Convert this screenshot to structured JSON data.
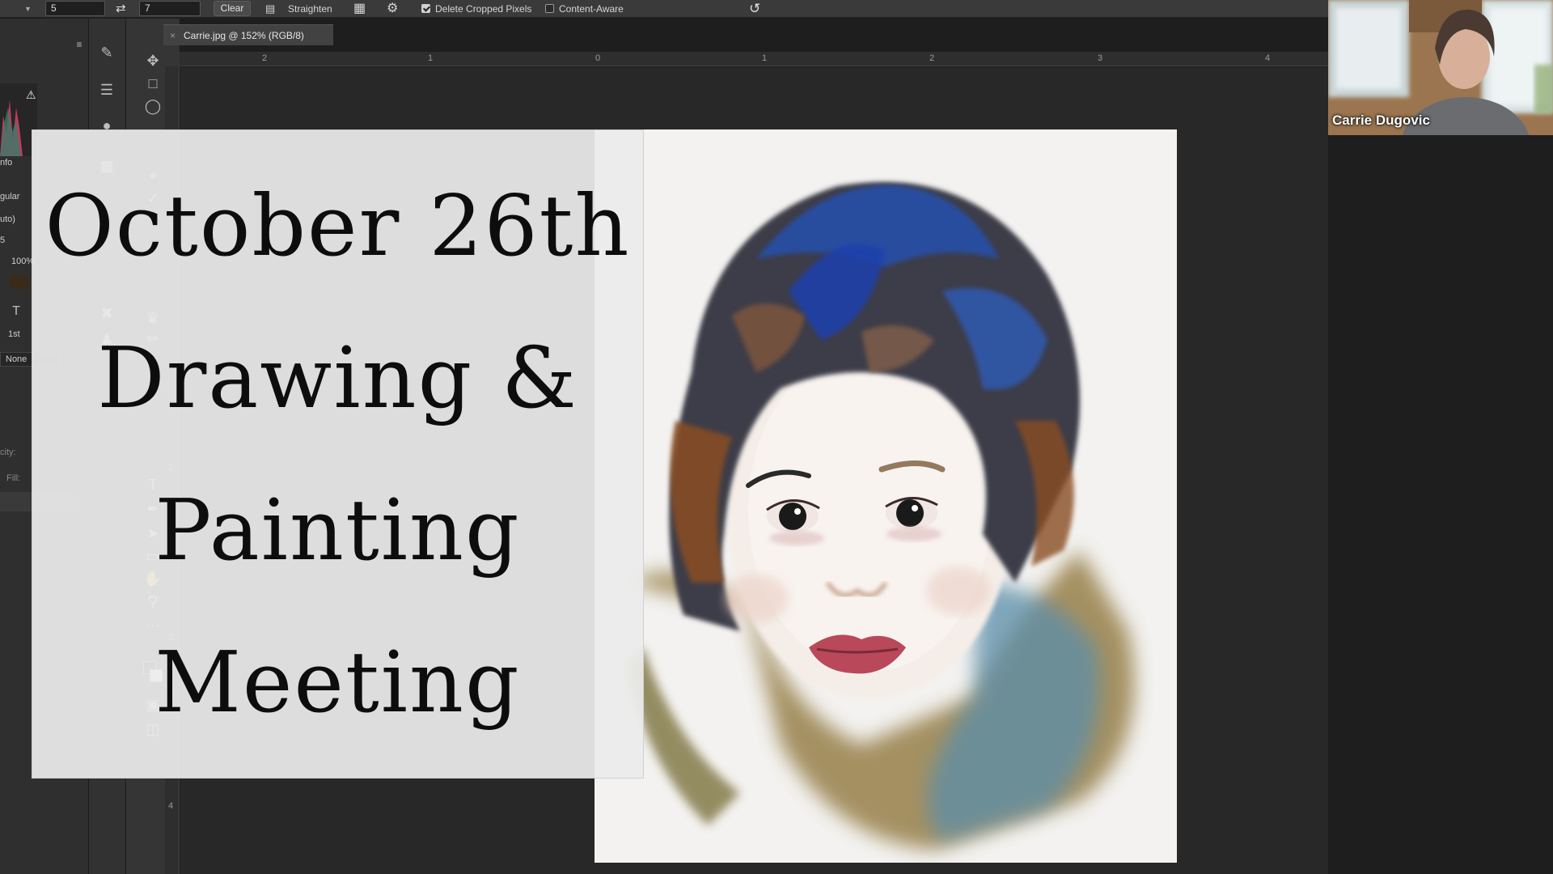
{
  "options_bar": {
    "width_value": "5",
    "height_value": "7",
    "clear_label": "Clear",
    "straighten_label": "Straighten",
    "delete_cropped_label": "Delete Cropped Pixels",
    "delete_cropped_checked": true,
    "content_aware_label": "Content-Aware",
    "content_aware_checked": false
  },
  "left_panel": {
    "info_tab": "nfo",
    "blend_mode": "gular",
    "auto_label": "uto)",
    "value_5": "5",
    "percent": "100%",
    "first_label": "1st",
    "none_label": "None",
    "opacity_label": "city:",
    "fill_label": "Fill:"
  },
  "document": {
    "tab_title": "Carrie.jpg @ 152% (RGB/8)",
    "ruler_h": [
      "2",
      "1",
      "0",
      "1",
      "2",
      "3",
      "4"
    ],
    "ruler_v": [
      "2",
      "3",
      "4"
    ]
  },
  "title_card": {
    "line1": "October 26th",
    "line2": "Drawing &",
    "line3": "Painting",
    "line4": "Meeting"
  },
  "video": {
    "participant_name": "Carrie Dugovic"
  },
  "colors": {
    "panel_bg": "#2f2f2f",
    "canvas_bg": "#282828",
    "card_bg": "#ececec",
    "ink": "#0d0d0d"
  }
}
